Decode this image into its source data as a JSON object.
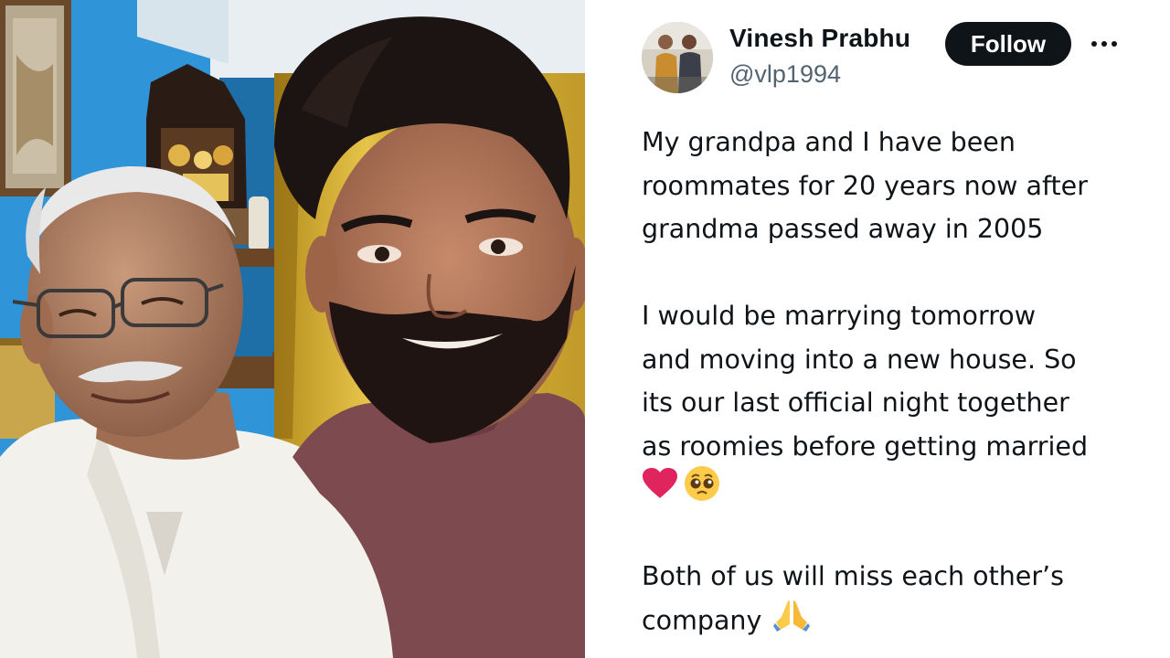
{
  "author": {
    "name": "Vinesh Prabhu",
    "handle": "@vlp1994"
  },
  "actions": {
    "follow_label": "Follow"
  },
  "tweet": {
    "p1": [
      "My grandpa and I have been",
      "roommates for 20 years now after",
      "grandma passed away in 2005"
    ],
    "p2": [
      "I would be marrying tomorrow",
      "and moving into a new house. So",
      "its our last official night together",
      "as roomies before getting married"
    ],
    "p2_emojis": [
      "red-heart-icon",
      "pleading-face-icon"
    ],
    "p3": [
      "Both of us will miss each other’s",
      "company"
    ],
    "p3_emoji": "folded-hands-icon"
  },
  "colors": {
    "text": "#0f1419",
    "secondary": "#536471",
    "follow_bg": "#0f1419",
    "heart": "#e0245e",
    "wall": "#2f95d8"
  }
}
